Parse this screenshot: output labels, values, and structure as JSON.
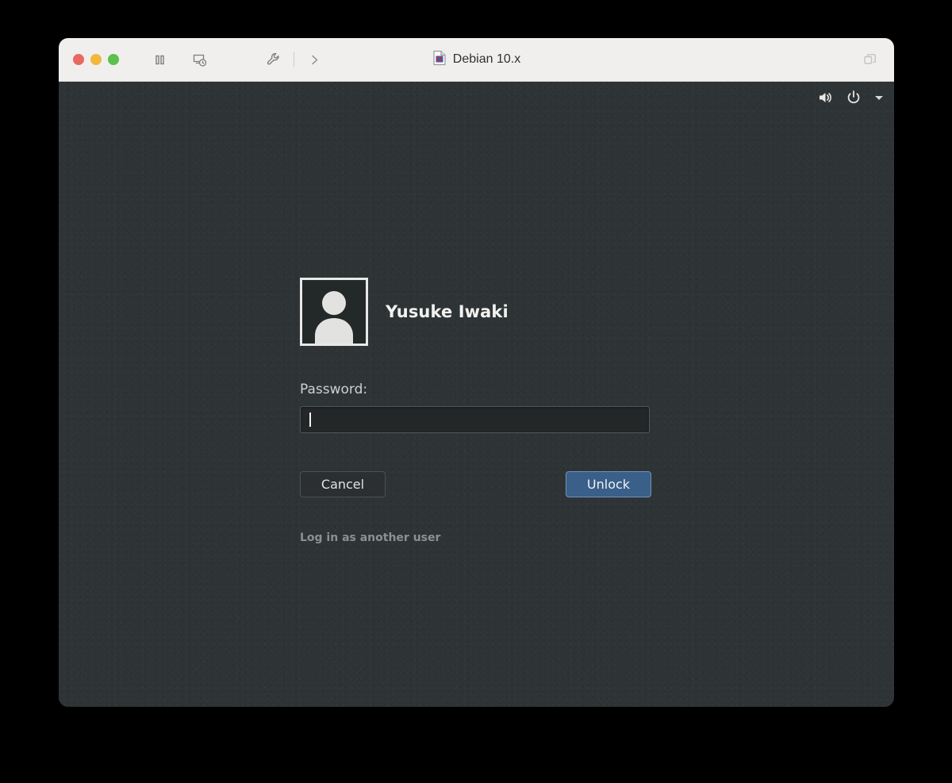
{
  "window": {
    "title": "Debian 10.x",
    "title_icon": "debian-document-icon",
    "traffic_lights": [
      {
        "name": "close",
        "color": "#e8695f"
      },
      {
        "name": "minimize",
        "color": "#f0b83f"
      },
      {
        "name": "maximize",
        "color": "#5cbf4e"
      }
    ],
    "toolbar_icons": [
      {
        "name": "pause-icon",
        "label": "Pause"
      },
      {
        "name": "snapshot-icon",
        "label": "Take Snapshot"
      },
      {
        "name": "wrench-icon",
        "label": "Settings"
      },
      {
        "name": "chevron-right-icon",
        "label": "Show More"
      }
    ],
    "right_icon": {
      "name": "restore-window-icon",
      "label": "Restore"
    }
  },
  "tray": {
    "items": [
      {
        "name": "volume-icon",
        "label": "Volume"
      },
      {
        "name": "power-icon",
        "label": "Power"
      },
      {
        "name": "chevron-down-icon",
        "label": "System Menu"
      }
    ]
  },
  "greeter": {
    "avatar_name": "default-user-avatar",
    "username": "Yusuke Iwaki",
    "password_label": "Password:",
    "password_value": "",
    "password_placeholder": "",
    "cancel_label": "Cancel",
    "unlock_label": "Unlock",
    "alt_login_label": "Log in as another user"
  },
  "colors": {
    "desktop_background": "#2e3436",
    "titlebar_background": "#f0efed",
    "unlock_accent": "#3a5f88",
    "page_background": "#000000"
  }
}
